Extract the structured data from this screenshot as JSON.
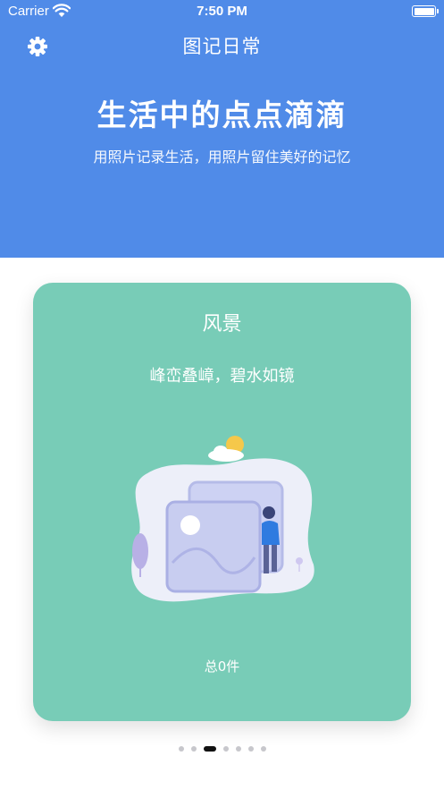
{
  "status_bar": {
    "carrier": "Carrier",
    "time": "7:50 PM"
  },
  "header": {
    "title": "图记日常",
    "headline": "生活中的点点滴滴",
    "subline": "用照片记录生活，用照片留住美好的记忆",
    "settings_icon": "gear-icon",
    "background_color": "#508be8"
  },
  "card": {
    "title": "风景",
    "subtitle": "峰峦叠嶂，碧水如镜",
    "count_label": "总0件",
    "background_color": "#78ccb7"
  },
  "pagination": {
    "total_pages": 7,
    "current_page": 3
  }
}
